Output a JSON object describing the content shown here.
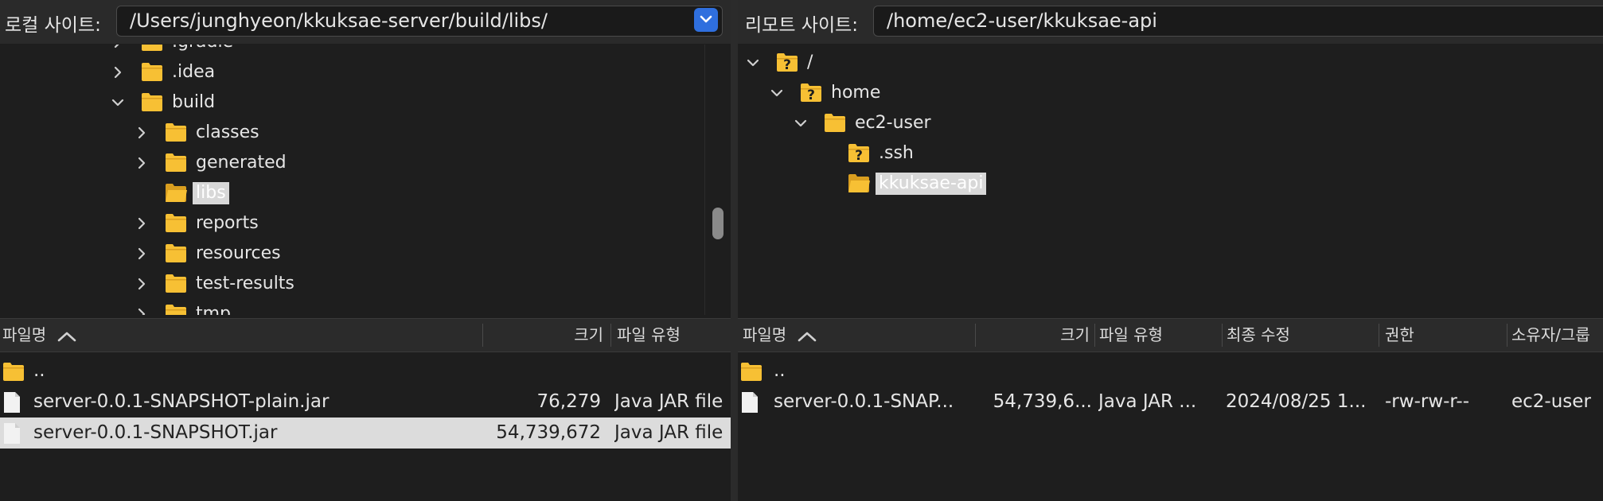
{
  "local": {
    "label": "로컬 사이트:",
    "path": "/Users/junghyeon/kkuksae-server/build/libs/",
    "tree": [
      {
        "name": ".gradle",
        "indent": 1,
        "chevron": "right",
        "icon": "folder",
        "selected": false
      },
      {
        "name": ".idea",
        "indent": 1,
        "chevron": "right",
        "icon": "folder",
        "selected": false
      },
      {
        "name": "build",
        "indent": 1,
        "chevron": "down",
        "icon": "folder",
        "selected": false
      },
      {
        "name": "classes",
        "indent": 2,
        "chevron": "right",
        "icon": "folder",
        "selected": false
      },
      {
        "name": "generated",
        "indent": 2,
        "chevron": "right",
        "icon": "folder",
        "selected": false
      },
      {
        "name": "libs",
        "indent": 2,
        "chevron": "none",
        "icon": "folder-open",
        "selected": true
      },
      {
        "name": "reports",
        "indent": 2,
        "chevron": "right",
        "icon": "folder",
        "selected": false
      },
      {
        "name": "resources",
        "indent": 2,
        "chevron": "right",
        "icon": "folder",
        "selected": false
      },
      {
        "name": "test-results",
        "indent": 2,
        "chevron": "right",
        "icon": "folder",
        "selected": false
      },
      {
        "name": "tmp",
        "indent": 2,
        "chevron": "right",
        "icon": "folder",
        "selected": false
      }
    ],
    "columns": {
      "name": "파일명",
      "size": "크기",
      "type": "파일 유형"
    },
    "files": [
      {
        "name": "..",
        "size": "",
        "type": "",
        "icon": "folder",
        "selected": false
      },
      {
        "name": "server-0.0.1-SNAPSHOT-plain.jar",
        "size": "76,279",
        "type": "Java JAR file",
        "icon": "file",
        "selected": false
      },
      {
        "name": "server-0.0.1-SNAPSHOT.jar",
        "size": "54,739,672",
        "type": "Java JAR file",
        "icon": "file",
        "selected": true
      }
    ]
  },
  "remote": {
    "label": "리모트 사이트:",
    "path": "/home/ec2-user/kkuksae-api",
    "tree": [
      {
        "name": "/",
        "indent": 0,
        "chevron": "down",
        "icon": "folder-question",
        "selected": false
      },
      {
        "name": "home",
        "indent": 1,
        "chevron": "down",
        "icon": "folder-question",
        "selected": false
      },
      {
        "name": "ec2-user",
        "indent": 2,
        "chevron": "down",
        "icon": "folder",
        "selected": false
      },
      {
        "name": ".ssh",
        "indent": 3,
        "chevron": "none",
        "icon": "folder-question",
        "selected": false
      },
      {
        "name": "kkuksae-api",
        "indent": 3,
        "chevron": "none",
        "icon": "folder-open",
        "selected": true
      }
    ],
    "columns": {
      "name": "파일명",
      "size": "크기",
      "type": "파일 유형",
      "modified": "최종 수정",
      "perms": "권한",
      "owner": "소유자/그룹"
    },
    "files": [
      {
        "name": "..",
        "size": "",
        "type": "",
        "modified": "",
        "perms": "",
        "owner": "",
        "icon": "folder"
      },
      {
        "name": "server-0.0.1-SNAP...",
        "size": "54,739,6...",
        "type": "Java JAR ...",
        "modified": "2024/08/25 1...",
        "perms": "-rw-rw-r--",
        "owner": "ec2-user",
        "icon": "file"
      }
    ]
  },
  "colors": {
    "folder": "#f7c034",
    "selection": "#d8d8d8",
    "accent": "#2f6fde"
  }
}
